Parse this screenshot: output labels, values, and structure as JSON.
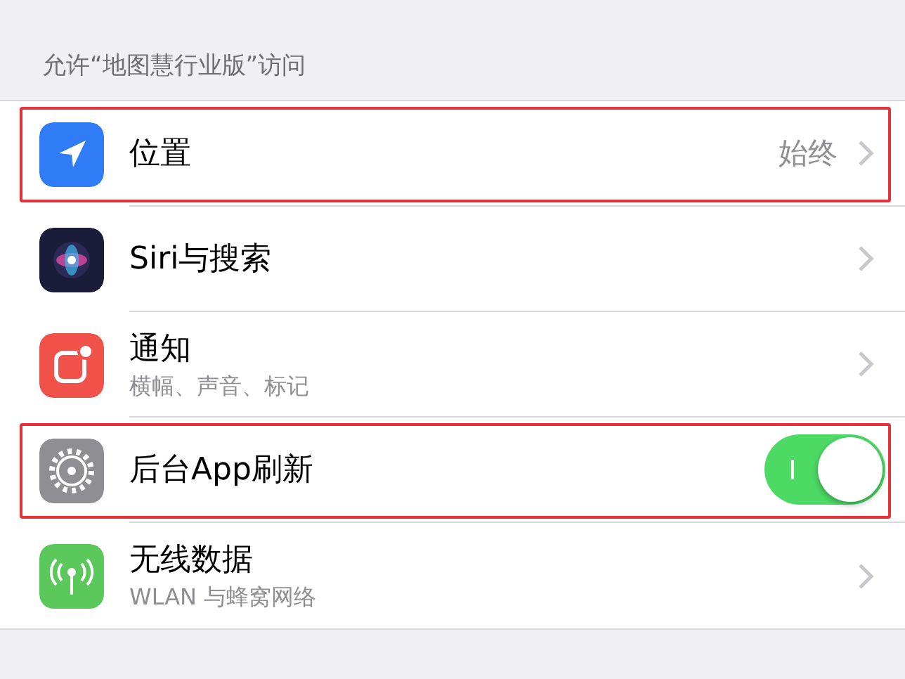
{
  "section_header": "允许“地图慧行业版”访问",
  "rows": [
    {
      "title": "位置",
      "value": "始终",
      "kind": "chevron",
      "highlighted": true
    },
    {
      "title": "Siri与搜索",
      "kind": "chevron",
      "highlighted": false
    },
    {
      "title": "通知",
      "subtitle": "横幅、声音、标记",
      "kind": "chevron",
      "highlighted": false
    },
    {
      "title": "后台App刷新",
      "kind": "toggle",
      "on": true,
      "highlighted": true
    },
    {
      "title": "无线数据",
      "subtitle": "WLAN 与蜂窝网络",
      "kind": "chevron",
      "highlighted": false
    }
  ]
}
